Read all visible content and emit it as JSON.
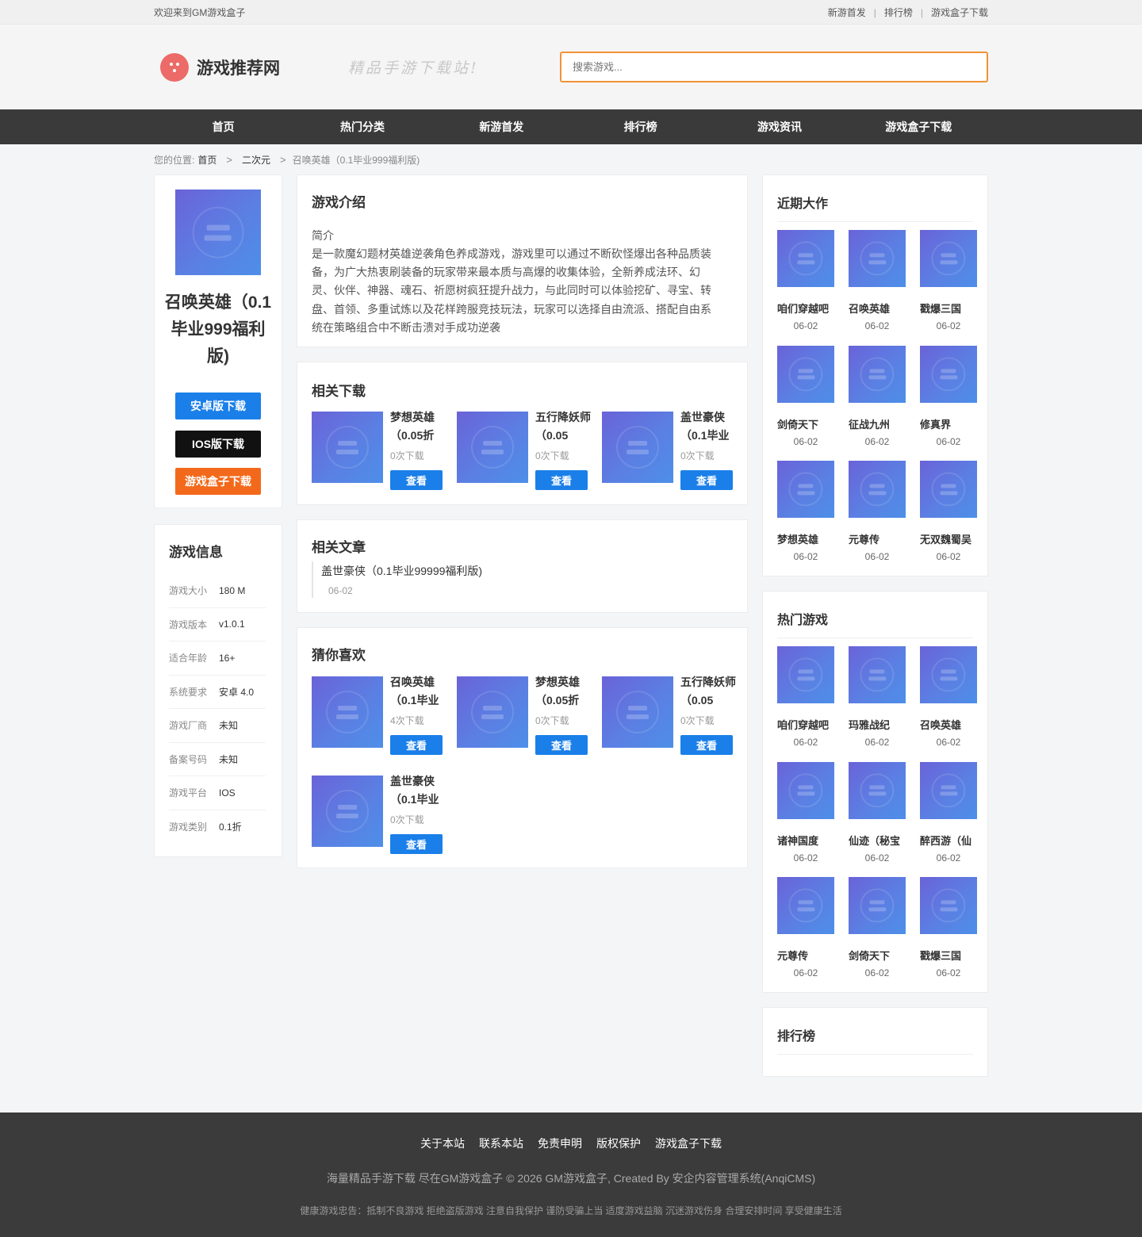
{
  "topbar": {
    "welcome": "欢迎来到GM游戏盒子",
    "links": [
      "新游首发",
      "排行榜",
      "游戏盒子下载"
    ],
    "sep": "|"
  },
  "header": {
    "logo_text": "游戏推荐网",
    "slogan": "精品手游下载站!",
    "search_placeholder": "搜索游戏..."
  },
  "nav": [
    "首页",
    "热门分类",
    "新游首发",
    "排行榜",
    "游戏资讯",
    "游戏盒子下载"
  ],
  "breadcrumb": {
    "prefix": "您的位置:",
    "items": [
      "首页",
      "二次元",
      "召唤英雄（0.1毕业999福利版)"
    ],
    "sep": ">"
  },
  "game": {
    "title": "召唤英雄（0.1毕业999福利版)",
    "buttons": {
      "android": "安卓版下载",
      "ios": "IOS版下载",
      "box": "游戏盒子下载"
    }
  },
  "game_info": {
    "heading": "游戏信息",
    "rows": [
      {
        "k": "游戏大小",
        "v": "180 M"
      },
      {
        "k": "游戏版本",
        "v": "v1.0.1"
      },
      {
        "k": "适合年龄",
        "v": "16+"
      },
      {
        "k": "系统要求",
        "v": "安卓 4.0"
      },
      {
        "k": "游戏厂商",
        "v": "未知"
      },
      {
        "k": "备案号码",
        "v": "未知"
      },
      {
        "k": "游戏平台",
        "v": "IOS"
      },
      {
        "k": "游戏类别",
        "v": "0.1折"
      }
    ]
  },
  "intro": {
    "heading": "游戏介绍",
    "sub": "简介",
    "lines": [
      "是一款魔幻题材英雄逆袭角色养成游戏，游戏里可以通过不断砍怪爆出各种品质装",
      "备，为广大热衷刷装备的玩家带来最本质与高爆的收集体验，全新养成法环、幻",
      "灵、伙伴、神器、魂石、祈愿树疯狂提升战力，与此同时可以体验挖矿、寻宝、转",
      "盘、首领、多重试炼以及花样跨服竞技玩法，玩家可以选择自由流派、搭配自由系",
      "统在策略组合中不断击溃对手成功逆袭"
    ]
  },
  "related": {
    "heading": "相关下载",
    "btn": "查看",
    "items": [
      {
        "name": "梦想英雄（0.05折",
        "count": "0次下载"
      },
      {
        "name": "五行降妖师（0.05",
        "count": "0次下载"
      },
      {
        "name": "盖世豪侠（0.1毕业",
        "count": "0次下载"
      }
    ]
  },
  "articles": {
    "heading": "相关文章",
    "items": [
      {
        "title": "盖世豪侠（0.1毕业99999福利版)",
        "date": "06-02"
      }
    ]
  },
  "guess": {
    "heading": "猜你喜欢",
    "btn": "查看",
    "items": [
      {
        "name": "召唤英雄（0.1毕业",
        "count": "4次下载"
      },
      {
        "name": "梦想英雄（0.05折",
        "count": "0次下载"
      },
      {
        "name": "五行降妖师（0.05",
        "count": "0次下载"
      },
      {
        "name": "盖世豪侠（0.1毕业",
        "count": "0次下载"
      }
    ]
  },
  "recent": {
    "heading": "近期大作",
    "items": [
      {
        "n": "咱们穿越吧",
        "d": "06-02"
      },
      {
        "n": "召唤英雄",
        "d": "06-02"
      },
      {
        "n": "戳爆三国",
        "d": "06-02"
      },
      {
        "n": "剑倚天下",
        "d": "06-02"
      },
      {
        "n": "征战九州",
        "d": "06-02"
      },
      {
        "n": "修真界",
        "d": "06-02"
      },
      {
        "n": "梦想英雄",
        "d": "06-02"
      },
      {
        "n": "元尊传",
        "d": "06-02"
      },
      {
        "n": "无双魏蜀吴",
        "d": "06-02"
      }
    ]
  },
  "hot": {
    "heading": "热门游戏",
    "items": [
      {
        "n": "咱们穿越吧",
        "d": "06-02"
      },
      {
        "n": "玛雅战纪",
        "d": "06-02"
      },
      {
        "n": "召唤英雄",
        "d": "06-02"
      },
      {
        "n": "诸神国度",
        "d": "06-02"
      },
      {
        "n": "仙迹（秘宝",
        "d": "06-02"
      },
      {
        "n": "醉西游（仙",
        "d": "06-02"
      },
      {
        "n": "元尊传",
        "d": "06-02"
      },
      {
        "n": "剑倚天下",
        "d": "06-02"
      },
      {
        "n": "戳爆三国",
        "d": "06-02"
      }
    ]
  },
  "rank": {
    "heading": "排行榜"
  },
  "footer": {
    "links": [
      "关于本站",
      "联系本站",
      "免责申明",
      "版权保护",
      "游戏盒子下载"
    ],
    "copyright": "海量精品手游下载 尽在GM游戏盒子 © 2026 GM游戏盒子, Created By 安企内容管理系统(AnqiCMS)",
    "warning": "健康游戏忠告：抵制不良游戏 拒绝盗版游戏 注意自我保护 谨防受骗上当 适度游戏益脑 沉迷游戏伤身 合理安排时间 享受健康生活"
  },
  "colors": {
    "accent_blue": "#1a7fe8",
    "orange": "#f3691b",
    "search_border": "#f39237",
    "nav_bg": "#3a3a3a",
    "footer_bg": "#3b3b3b",
    "logo_red": "#ec6a68"
  }
}
